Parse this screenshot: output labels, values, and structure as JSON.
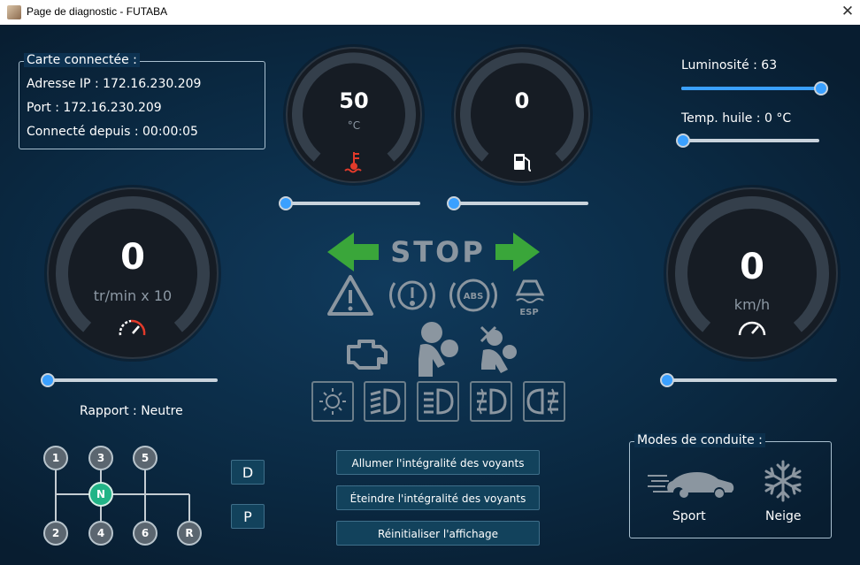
{
  "window": {
    "title": "Page de diagnostic - FUTABA",
    "close_symbol": "✕"
  },
  "connection": {
    "legend": "Carte connectée :",
    "ip": "Adresse IP : 172.16.230.209",
    "port": "Port : 172.16.230.209",
    "uptime": "Connecté depuis : 00:00:05"
  },
  "gauges": {
    "temperature": {
      "value": "50",
      "unit": "°C",
      "icon": "coolant-temperature-icon"
    },
    "fuel": {
      "value": "0",
      "unit": "",
      "icon": "fuel-pump-icon"
    },
    "rpm": {
      "value": "0",
      "unit": "tr/min x 10",
      "icon": "tachometer-icon"
    },
    "speed": {
      "value": "0",
      "unit": "km/h",
      "icon": "speedometer-icon"
    }
  },
  "sliders": {
    "temperature": {
      "fraction": 0.0
    },
    "fuel": {
      "fraction": 0.0
    },
    "rpm": {
      "fraction": 0.0
    },
    "speed": {
      "fraction": 0.0
    },
    "brightness": {
      "fraction": 1.0
    },
    "oil_temp": {
      "fraction": 0.0
    }
  },
  "settings": {
    "brightness_label": "Luminosité : 63",
    "oil_temp_label": "Temp. huile : 0 °C"
  },
  "indicators": {
    "stop_text": "STOP",
    "abs_text": "ABS",
    "esp_text": "ESP",
    "arrow_color": "#3aa63a",
    "inactive_color": "#8b96a0"
  },
  "gearbox": {
    "label": "Rapport : Neutre",
    "gears": [
      "1",
      "3",
      "5",
      "N",
      "2",
      "4",
      "6",
      "R"
    ],
    "auto": [
      "D",
      "P"
    ]
  },
  "actions": {
    "all_on": "Allumer l'intégralité des voyants",
    "all_off": "Éteindre l'intégralité des voyants",
    "reset": "Réinitialiser l'affichage"
  },
  "drive_modes": {
    "legend": "Modes de conduite :",
    "sport": "Sport",
    "snow": "Neige"
  }
}
